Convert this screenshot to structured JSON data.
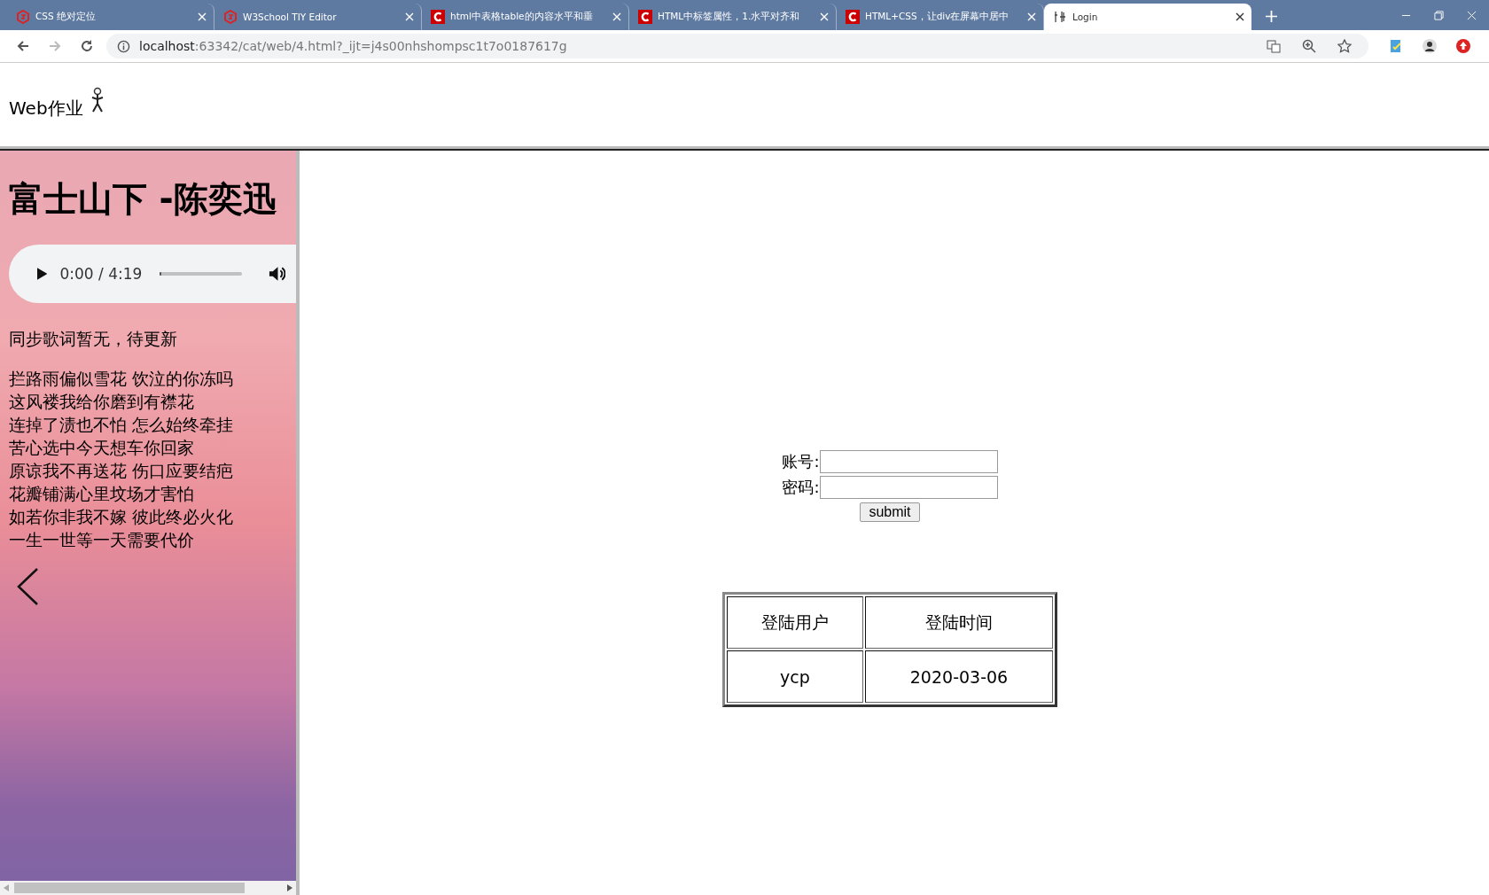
{
  "browser": {
    "tabs": [
      {
        "kind": "w3school",
        "title": "CSS 绝对定位",
        "selected": false
      },
      {
        "kind": "w3school",
        "title": "W3School TIY Editor",
        "selected": false
      },
      {
        "kind": "csdn",
        "title": "html中表格table的内容水平和垂",
        "selected": false
      },
      {
        "kind": "csdn",
        "title": "HTML中标签属性，1.水平对齐和",
        "selected": false
      },
      {
        "kind": "csdn",
        "title": "HTML+CSS，让div在屏幕中居中",
        "selected": false
      },
      {
        "kind": "page",
        "title": "Login",
        "selected": true
      }
    ],
    "address": {
      "host": "localhost",
      "path": ":63342/cat/web/4.html?_ijt=j4s00nhshompsc1t7o0187617g"
    }
  },
  "header": {
    "title": "Web作业"
  },
  "sidebar": {
    "song_title": "富士山下 -陈奕迅",
    "player": {
      "time": "0:00 / 4:19",
      "level": 0
    },
    "notice": "同步歌词暂无，待更新",
    "lyrics": [
      "拦路雨偏似雪花 饮泣的你冻吗",
      "这风褛我给你磨到有襟花",
      "连掉了渍也不怕 怎么始终牵挂",
      "苦心选中今天想车你回家",
      "原谅我不再送花 伤口应要结疤",
      "花瓣铺满心里坟场才害怕",
      "如若你非我不嫁 彼此终必火化",
      "一生一世等一天需要代价"
    ]
  },
  "login": {
    "fields": [
      {
        "label": "账号:"
      },
      {
        "label": "密码:"
      }
    ],
    "submit": "submit"
  },
  "table": {
    "columns": [
      "登陆用户",
      "登陆时间"
    ],
    "rows": [
      [
        "ycp",
        "2020-03-06"
      ]
    ]
  }
}
